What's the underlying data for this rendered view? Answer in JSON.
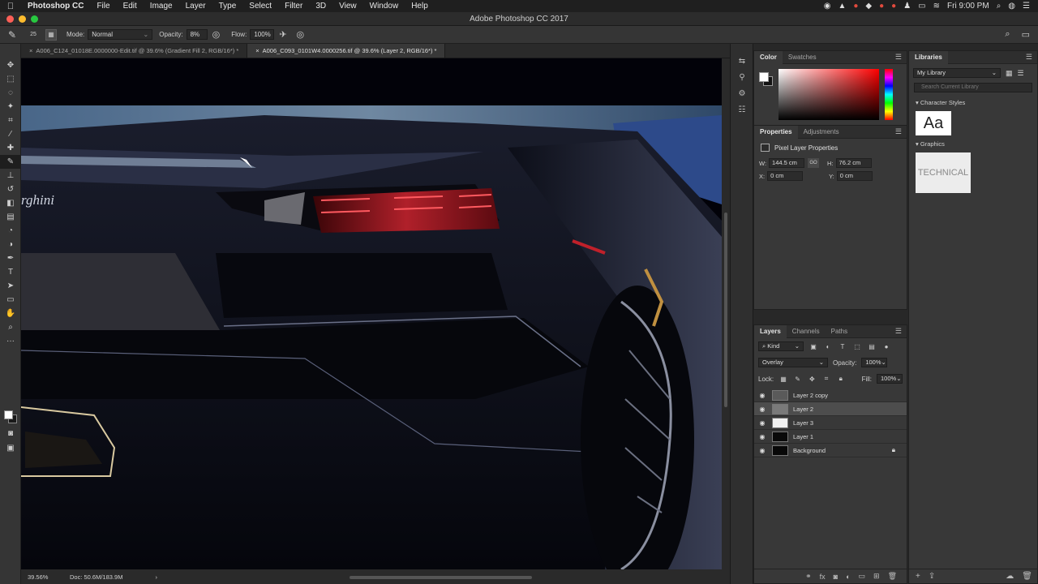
{
  "menubar": {
    "apple_icon": "apple-icon",
    "items": [
      "Photoshop CC",
      "File",
      "Edit",
      "Image",
      "Layer",
      "Type",
      "Select",
      "Filter",
      "3D",
      "View",
      "Window",
      "Help"
    ],
    "clock": "Fri 9:00 PM",
    "status_icons": [
      "record-icon",
      "drive-icon",
      "cloud-icon",
      "dropbox-icon",
      "adobe-icon",
      "sync-icon",
      "user-icon",
      "display-icon",
      "wifi-icon",
      "search-icon",
      "siri-icon",
      "menu-icon"
    ]
  },
  "window": {
    "title": "Adobe Photoshop CC 2017"
  },
  "options": {
    "brush_size": "25",
    "mode_label": "Mode:",
    "mode_value": "Normal",
    "opacity_label": "Opacity:",
    "opacity_value": "8%",
    "flow_label": "Flow:",
    "flow_value": "100%"
  },
  "tabs": [
    {
      "label": "A006_C124_01018E.0000000-Edit.tif @ 39.6% (Gradient Fill 2, RGB/16*) *",
      "active": false
    },
    {
      "label": "A006_C093_0101W4.0000256.tif @ 39.6% (Layer 2, RGB/16*) *",
      "active": true
    }
  ],
  "canvas": {
    "badge_text": "rghini"
  },
  "status": {
    "zoom": "39.56%",
    "doc": "Doc: 50.6M/183.9M",
    "arrow": "›"
  },
  "color_panel": {
    "tabs": [
      "Color",
      "Swatches"
    ],
    "fg_color": "#ffffff",
    "bg_color": "#141414"
  },
  "properties_panel": {
    "tabs": [
      "Properties",
      "Adjustments"
    ],
    "heading": "Pixel Layer Properties",
    "w_label": "W:",
    "w_value": "144.5 cm",
    "link": "GO",
    "h_label": "H:",
    "h_value": "76.2 cm",
    "x_label": "X:",
    "x_value": "0 cm",
    "y_label": "Y:",
    "y_value": "0 cm"
  },
  "layers_panel": {
    "tabs": [
      "Layers",
      "Channels",
      "Paths"
    ],
    "kind_label": "Kind",
    "blend_mode": "Overlay",
    "opacity_label": "Opacity:",
    "opacity_value": "100%",
    "lock_label": "Lock:",
    "fill_label": "Fill:",
    "fill_value": "100%",
    "layers": [
      {
        "name": "Layer 2 copy",
        "selected": false,
        "thumb": "#5a5a5a",
        "locked": false
      },
      {
        "name": "Layer 2",
        "selected": true,
        "thumb": "#7a7a7a",
        "locked": false
      },
      {
        "name": "Layer 3",
        "selected": false,
        "thumb": "#f0f0f0",
        "locked": false
      },
      {
        "name": "Layer 1",
        "selected": false,
        "thumb": "#0a0a0a",
        "locked": false
      },
      {
        "name": "Background",
        "selected": false,
        "thumb": "#080808",
        "locked": true
      }
    ]
  },
  "libraries_panel": {
    "tab": "Libraries",
    "library_name": "My Library",
    "search_placeholder": "Search Current Library",
    "section_character_styles": "Character Styles",
    "aa_sample": "Aa",
    "section_graphics": "Graphics",
    "graphic_text": "TECHNICAL"
  }
}
